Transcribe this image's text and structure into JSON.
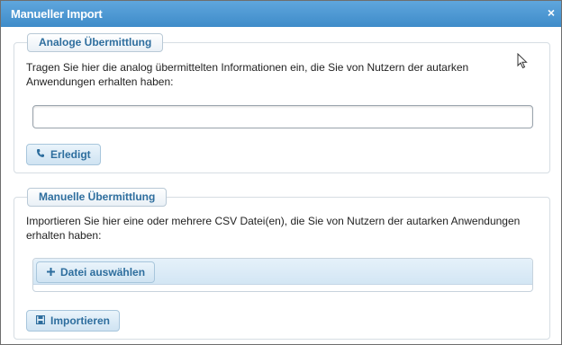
{
  "window": {
    "title": "Manueller Import",
    "close_symbol": "×"
  },
  "analog": {
    "legend": "Analoge Übermittlung",
    "description": "Tragen Sie hier die analog übermittelten Informationen ein, die Sie von Nutzern der autarken Anwendungen erhalten haben:",
    "input_value": "",
    "button_label": "Erledigt",
    "button_icon": "phone-icon"
  },
  "manual": {
    "legend": "Manuelle Übermittlung",
    "description": "Importieren Sie hier eine oder mehrere CSV Datei(en), die Sie von Nutzern der autarken Anwendungen erhalten haben:",
    "file_button_label": "Datei auswählen",
    "file_button_icon": "plus-icon",
    "import_button_label": "Importieren",
    "import_button_icon": "save-icon"
  },
  "colors": {
    "titlebar": "#4a96d2",
    "accent_text": "#2e6e9e",
    "button_bg": "#d9eaf6",
    "border": "#d6dde3"
  }
}
